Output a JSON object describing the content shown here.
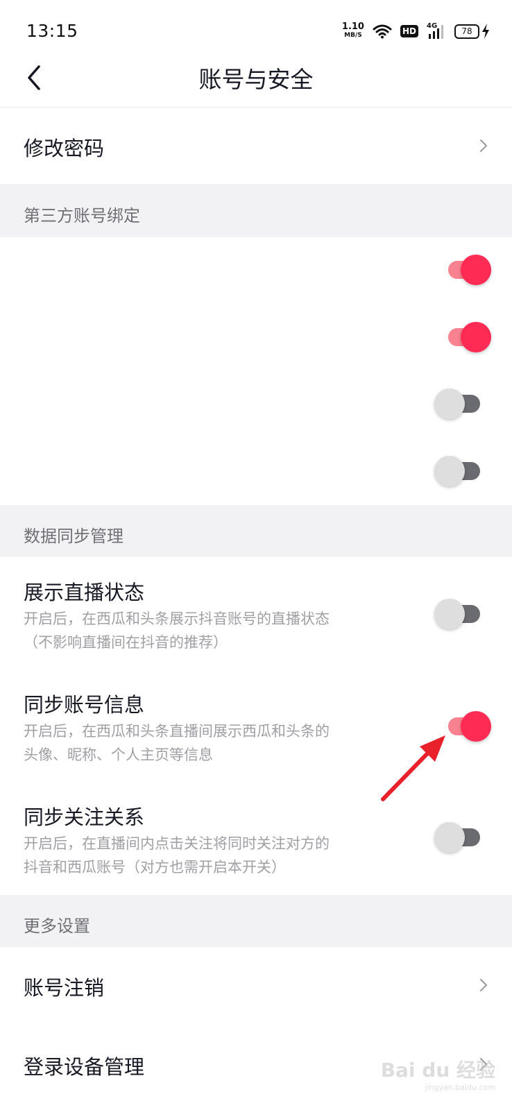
{
  "status_bar": {
    "time": "13:15",
    "net_speed_value": "1.10",
    "net_speed_unit": "MB/S",
    "hd_label": "HD",
    "network_label": "4G",
    "battery_level": "78"
  },
  "nav": {
    "title": "账号与安全",
    "back_icon": "chevron-left-icon"
  },
  "rows": {
    "change_password": "修改密码"
  },
  "sections": {
    "third_party": "第三方账号绑定",
    "data_sync": "数据同步管理",
    "more": "更多设置"
  },
  "third_party_bindings": [
    {
      "label": "",
      "enabled": true
    },
    {
      "label": "",
      "enabled": true
    },
    {
      "label": "",
      "enabled": false
    },
    {
      "label": "",
      "enabled": false
    }
  ],
  "sync_settings": [
    {
      "title": "展示直播状态",
      "desc_line1": "开启后，在西瓜和头条展示抖音账号的直播状态",
      "desc_line2": "（不影响直播间在抖音的推荐）",
      "enabled": false
    },
    {
      "title": "同步账号信息",
      "desc_line1": "开启后，在西瓜和头条直播间展示西瓜和头条的",
      "desc_line2": "头像、昵称、个人主页等信息",
      "enabled": true
    },
    {
      "title": "同步关注关系",
      "desc_line1": "开启后，在直播间内点击关注将同时关注对方的",
      "desc_line2": "抖音和西瓜账号（对方也需开启本开关）",
      "enabled": false
    }
  ],
  "more_settings": {
    "account_cancel": "账号注销",
    "device_manage": "登录设备管理"
  },
  "watermark": {
    "text": "Bai du 经验",
    "url": "jingyan.baidu.com"
  },
  "colors": {
    "accent": "#fe2c55",
    "accent_track": "#f8828f",
    "off_track": "#6a6b70",
    "off_knob": "#dedede",
    "section_bg": "#f2f2f4",
    "annotation_arrow": "#e8212b"
  }
}
